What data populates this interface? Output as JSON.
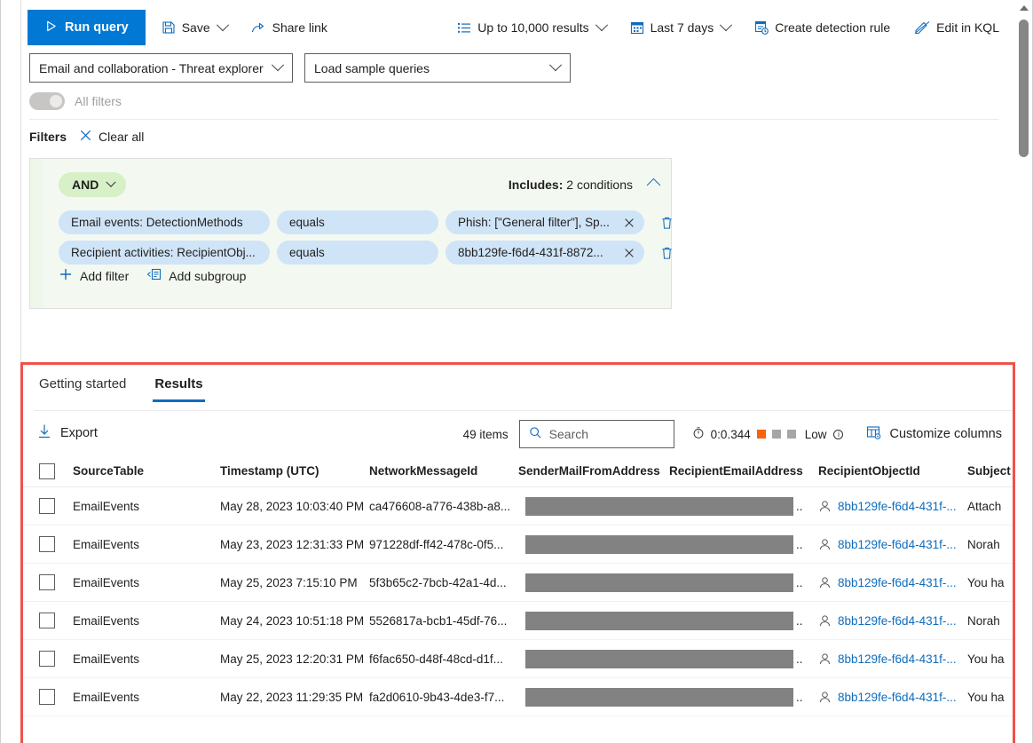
{
  "toolbar": {
    "run_query": "Run query",
    "save": "Save",
    "share_link": "Share link",
    "results_limit": "Up to 10,000 results",
    "time_range": "Last 7 days",
    "create_detection_rule": "Create detection rule",
    "edit_in_kql": "Edit in KQL",
    "icons": {
      "run": "play-icon",
      "save": "save-icon",
      "share": "share-icon",
      "results_limit": "list-icon",
      "calendar": "calendar-icon",
      "detection_rule": "detection-rule-icon",
      "kql": "kql-edit-icon"
    },
    "accent_color": "#0078d4"
  },
  "selectors": {
    "schema": "Email and collaboration - Threat explorer",
    "sample_queries": "Load sample queries"
  },
  "all_filters": {
    "label": "All filters",
    "state": "on-disabled"
  },
  "filters": {
    "title": "Filters",
    "clear_all": "Clear all",
    "group": {
      "operator": "AND",
      "includes_label": "Includes:",
      "includes_value": "2 conditions",
      "conditions": [
        {
          "field": "Email events: DetectionMethods",
          "operator": "equals",
          "value": "Phish: [\"General filter\"], Sp...",
          "remove": "X",
          "delete": "delete-icon"
        },
        {
          "field": "Recipient activities: RecipientObj...",
          "operator": "equals",
          "value": "8bb129fe-f6d4-431f-8872...",
          "remove": "X",
          "delete": "delete-icon"
        }
      ],
      "add_filter": "Add filter",
      "add_subgroup": "Add subgroup"
    }
  },
  "results": {
    "tabs": [
      {
        "label": "Getting started",
        "active": false
      },
      {
        "label": "Results",
        "active": true
      }
    ],
    "export": "Export",
    "items_count": "49 items",
    "search_placeholder": "Search",
    "perf_time": "0:0.344",
    "perf_level": "Low",
    "perf_squares": [
      "on",
      "off",
      "off"
    ],
    "customize_columns": "Customize columns",
    "highlight_color": "#f0524b",
    "columns": [
      "SourceTable",
      "Timestamp (UTC)",
      "NetworkMessageId",
      "SenderMailFromAddress",
      "RecipientEmailAddress",
      "RecipientObjectId",
      "Subject"
    ],
    "rows": [
      {
        "source_table": "EmailEvents",
        "timestamp": "May 28, 2023 10:03:40 PM",
        "network_message_id": "ca476608-a776-438b-a8...",
        "sender_recipient_redacted": true,
        "redacted_suffix": "..",
        "recipient_object_id": "8bb129fe-f6d4-431f-...",
        "subject": "Attach"
      },
      {
        "source_table": "EmailEvents",
        "timestamp": "May 23, 2023 12:31:33 PM",
        "network_message_id": "971228df-ff42-478c-0f5...",
        "sender_recipient_redacted": true,
        "redacted_suffix": "..",
        "recipient_object_id": "8bb129fe-f6d4-431f-...",
        "subject": "Norah"
      },
      {
        "source_table": "EmailEvents",
        "timestamp": "May 25, 2023 7:15:10 PM",
        "network_message_id": "5f3b65c2-7bcb-42a1-4d...",
        "sender_recipient_redacted": true,
        "redacted_suffix": "..",
        "recipient_object_id": "8bb129fe-f6d4-431f-...",
        "subject": "You ha"
      },
      {
        "source_table": "EmailEvents",
        "timestamp": "May 24, 2023 10:51:18 PM",
        "network_message_id": "5526817a-bcb1-45df-76...",
        "sender_recipient_redacted": true,
        "redacted_suffix": "..",
        "recipient_object_id": "8bb129fe-f6d4-431f-...",
        "subject": "Norah"
      },
      {
        "source_table": "EmailEvents",
        "timestamp": "May 25, 2023 12:20:31 PM",
        "network_message_id": "f6fac650-d48f-48cd-d1f...",
        "sender_recipient_redacted": true,
        "redacted_suffix": "..",
        "recipient_object_id": "8bb129fe-f6d4-431f-...",
        "subject": "You ha"
      },
      {
        "source_table": "EmailEvents",
        "timestamp": "May 22, 2023 11:29:35 PM",
        "network_message_id": "fa2d0610-9b43-4de3-f7...",
        "sender_recipient_redacted": true,
        "redacted_suffix": "..",
        "recipient_object_id": "8bb129fe-f6d4-431f-...",
        "subject": "You ha"
      }
    ]
  }
}
